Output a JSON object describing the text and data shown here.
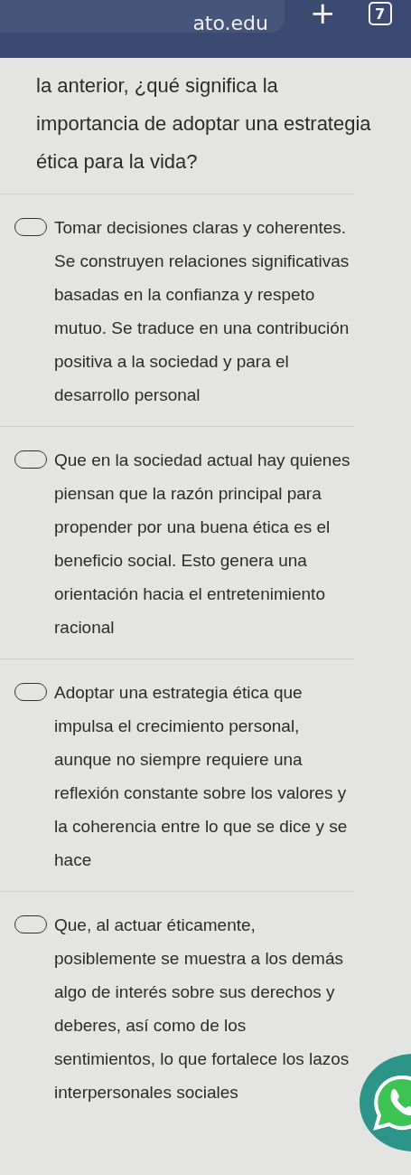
{
  "browser_bar": {
    "address": "ato.edu",
    "new_tab": "+",
    "tab_count": "7"
  },
  "question": "la anterior, ¿qué significa la importancia de adoptar una estrategia ética para la vida?",
  "options": [
    {
      "text": "Tomar decisiones claras y coherentes. Se construyen relaciones significativas basadas en la confianza y respeto mutuo. Se traduce en una contribución positiva a la sociedad y para el desarrollo personal",
      "selected": false
    },
    {
      "text": "Que en la sociedad actual hay quienes piensan que la razón principal para propender por una buena ética es el beneficio social. Esto genera una orientación hacia el entretenimiento racional",
      "selected": false
    },
    {
      "text": "Adoptar una estrategia ética que impulsa el crecimiento personal, aunque no siempre requiere una reflexión constante sobre los valores y la coherencia entre lo que se dice y se hace",
      "selected": false
    },
    {
      "text": "Que, al actuar éticamente, posiblemente se muestra a los demás algo de interés sobre sus derechos y deberes, así como de los sentimientos, lo que fortalece los lazos interpersonales sociales",
      "selected": false
    }
  ]
}
